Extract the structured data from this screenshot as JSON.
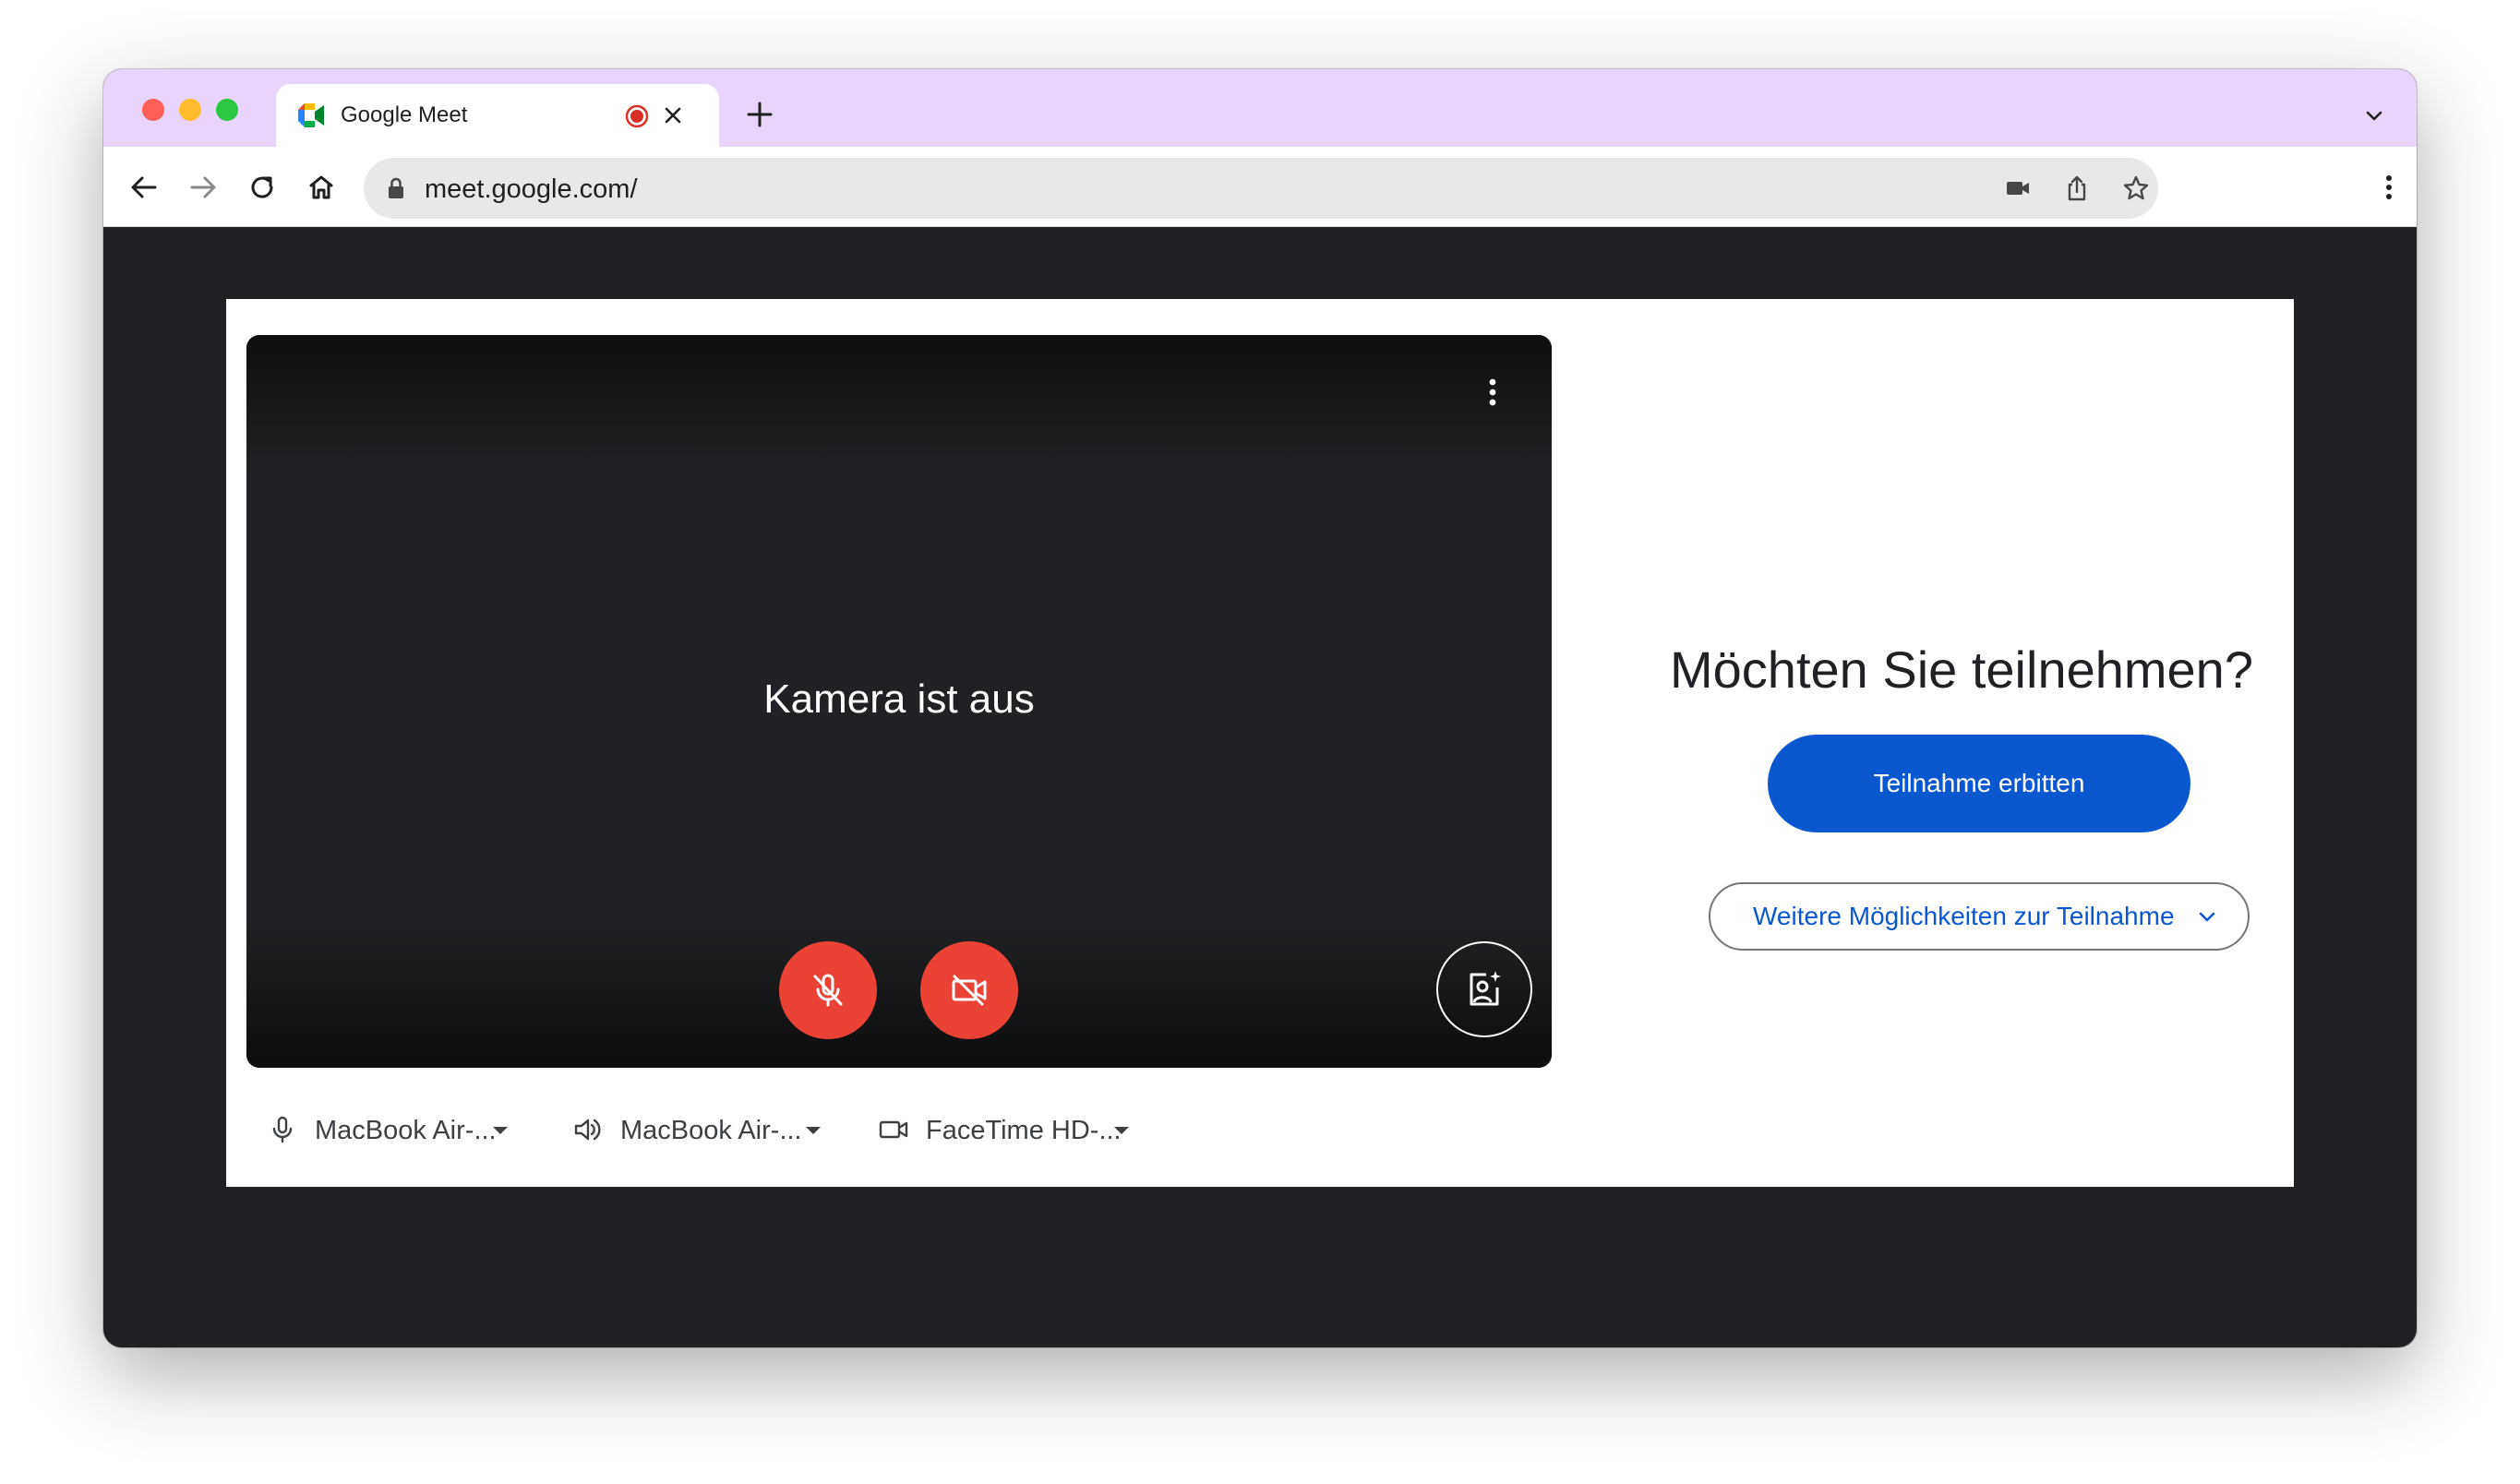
{
  "browser": {
    "tab": {
      "title": "Google Meet"
    },
    "address": {
      "url": "meet.google.com/"
    }
  },
  "preview": {
    "camera_off_text": "Kamera ist aus"
  },
  "devices": {
    "microphone": "MacBook Air-...",
    "speaker": "MacBook Air-...",
    "camera": "FaceTime HD-..."
  },
  "join": {
    "title": "Möchten Sie teilnehmen?",
    "request_button": "Teilnahme erbitten",
    "more_options_button": "Weitere Möglichkeiten zur Teilnahme"
  },
  "colors": {
    "titlebar": "#e9d5fb",
    "page_background": "#202124",
    "primary_blue": "#0b57d0",
    "control_red": "#ea4335"
  }
}
